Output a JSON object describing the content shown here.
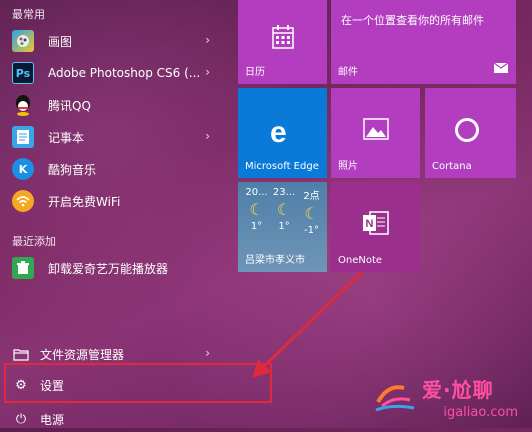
{
  "start_menu": {
    "most_used_label": "最常用",
    "most_used": [
      {
        "label": "画图",
        "icon": "paint-icon"
      },
      {
        "label": "Adobe Photoshop CS6 (...",
        "icon": "photoshop-icon",
        "icon_text": "Ps"
      },
      {
        "label": "腾讯QQ",
        "icon": "qq-icon"
      },
      {
        "label": "记事本",
        "icon": "notepad-icon"
      },
      {
        "label": "酷狗音乐",
        "icon": "kugou-icon",
        "icon_text": "K"
      },
      {
        "label": "开启免费WiFi",
        "icon": "wifi-icon"
      }
    ],
    "recent_label": "最近添加",
    "recent": [
      {
        "label": "卸载爱奇艺万能播放器",
        "icon": "uninstall-icon"
      }
    ],
    "system": [
      {
        "label": "文件资源管理器",
        "icon": "file-explorer-icon"
      },
      {
        "label": "设置",
        "icon": "gear-icon"
      },
      {
        "label": "电源",
        "icon": "power-icon"
      }
    ]
  },
  "tiles": {
    "calendar": {
      "label": "日历"
    },
    "mail": {
      "label": "邮件",
      "headline": "在一个位置查看你的所有邮件"
    },
    "edge": {
      "label": "Microsoft Edge"
    },
    "photos": {
      "label": "照片"
    },
    "cortana": {
      "label": "Cortana"
    },
    "weather": {
      "location": "吕梁市孝义市",
      "days": [
        {
          "time": "20...",
          "temp": "1°"
        },
        {
          "time": "23...",
          "temp": "1°"
        },
        {
          "time": "2点",
          "temp": "-1°"
        }
      ]
    },
    "onenote": {
      "label": "OneNote"
    }
  },
  "watermark": {
    "brand": "爱·尬聊",
    "url": "igaliao.com"
  },
  "colors": {
    "tile_purple": "#b23dbe",
    "tile_blue": "#0a79d8",
    "highlight": "#e0293b"
  }
}
